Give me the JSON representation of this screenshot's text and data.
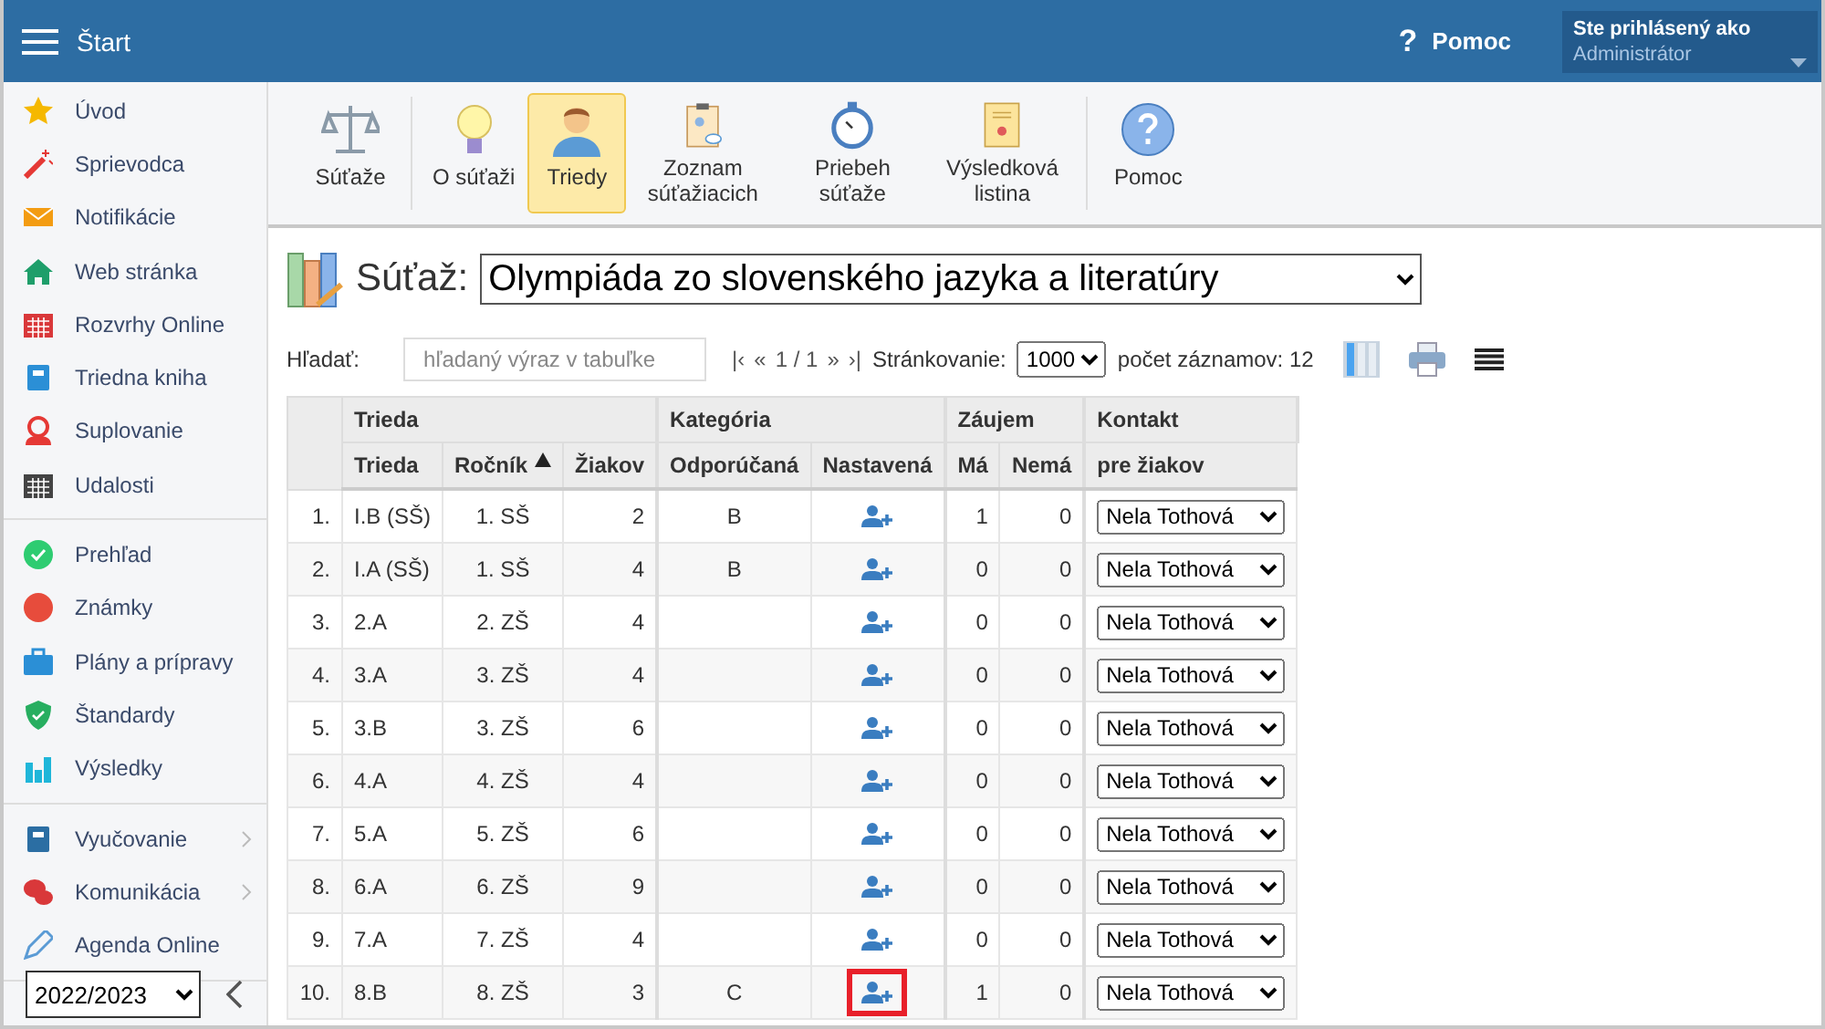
{
  "header": {
    "title": "Štart",
    "help_icon": "?",
    "help": "Pomoc",
    "user_label": "Ste prihlásený ako",
    "user_name": "Administrátor"
  },
  "sidebar": {
    "groups": [
      [
        {
          "label": "Úvod",
          "kind": "star",
          "submenu": false
        },
        {
          "label": "Sprievodca",
          "kind": "wand",
          "submenu": false
        },
        {
          "label": "Notifikácie",
          "kind": "mail",
          "submenu": false
        },
        {
          "label": "Web stránka",
          "kind": "home",
          "submenu": false
        },
        {
          "label": "Rozvrhy Online",
          "kind": "calendar",
          "submenu": false
        },
        {
          "label": "Triedna kniha",
          "kind": "book",
          "submenu": false
        },
        {
          "label": "Suplovanie",
          "kind": "person",
          "submenu": false
        },
        {
          "label": "Udalosti",
          "kind": "events",
          "submenu": false
        }
      ],
      [
        {
          "label": "Prehľad",
          "kind": "check",
          "submenu": false
        },
        {
          "label": "Známky",
          "kind": "grade",
          "submenu": false
        },
        {
          "label": "Plány a prípravy",
          "kind": "briefcase",
          "submenu": false
        },
        {
          "label": "Štandardy",
          "kind": "shield",
          "submenu": false
        },
        {
          "label": "Výsledky",
          "kind": "chart",
          "submenu": false
        }
      ],
      [
        {
          "label": "Vyučovanie",
          "kind": "reading",
          "submenu": true
        },
        {
          "label": "Komunikácia",
          "kind": "chat",
          "submenu": true
        },
        {
          "label": "Agenda Online",
          "kind": "pen",
          "submenu": false
        }
      ]
    ],
    "year": "2022/2023"
  },
  "toolbar": [
    [
      {
        "label": "Súťaže",
        "kind": "scales",
        "selected": false
      }
    ],
    [
      {
        "label": "O súťaži",
        "kind": "bulb",
        "selected": false
      },
      {
        "label": "Triedy",
        "kind": "person",
        "selected": true
      },
      {
        "label": "Zoznam súťažiacich",
        "kind": "clipboard",
        "selected": false
      },
      {
        "label": "Priebeh súťaže",
        "kind": "stopwatch",
        "selected": false
      },
      {
        "label": "Výsledková listina",
        "kind": "certificate",
        "selected": false
      }
    ],
    [
      {
        "label": "Pomoc",
        "kind": "help",
        "selected": false
      }
    ]
  ],
  "title": {
    "label": "Súťaž:",
    "value": "Olympiáda zo slovenského jazyka a literatúry"
  },
  "filter": {
    "label": "Hľadať:",
    "placeholder": "hľadaný výraz v tabuľke",
    "pager": [
      "|‹",
      "«",
      "1 / 1",
      "»",
      "›|"
    ],
    "paging_label": "Stránkovanie:",
    "paging_value": "1000",
    "count": "počet záznamov: 12"
  },
  "table": {
    "groups": [
      {
        "label": "Trieda"
      },
      {
        "label": "Kategória"
      },
      {
        "label": "Záujem"
      },
      {
        "label": "Kontakt"
      }
    ],
    "columns": [
      {
        "label": "Trieda",
        "sorted": false
      },
      {
        "label": "Ročník",
        "sorted": true
      },
      {
        "label": "Žiakov",
        "sorted": false
      },
      {
        "label": "Odporúčaná",
        "sorted": false
      },
      {
        "label": "Nastavená",
        "sorted": false
      },
      {
        "label": "Má",
        "sorted": false
      },
      {
        "label": "Nemá",
        "sorted": false
      },
      {
        "label": "pre žiakov",
        "sorted": false
      }
    ],
    "rows": [
      {
        "n": "1.",
        "trieda": "I.B (SŠ)",
        "rocnik": "1. SŠ",
        "ziakov": "2",
        "odporucana": "B",
        "ma": "1",
        "nema": "0",
        "kontakt": "Nela Tothová",
        "marked": false
      },
      {
        "n": "2.",
        "trieda": "I.A (SŠ)",
        "rocnik": "1. SŠ",
        "ziakov": "4",
        "odporucana": "B",
        "ma": "0",
        "nema": "0",
        "kontakt": "Nela Tothová",
        "marked": false
      },
      {
        "n": "3.",
        "trieda": "2.A",
        "rocnik": "2. ZŠ",
        "ziakov": "4",
        "odporucana": "",
        "ma": "0",
        "nema": "0",
        "kontakt": "Nela Tothová",
        "marked": false
      },
      {
        "n": "4.",
        "trieda": "3.A",
        "rocnik": "3. ZŠ",
        "ziakov": "4",
        "odporucana": "",
        "ma": "0",
        "nema": "0",
        "kontakt": "Nela Tothová",
        "marked": false
      },
      {
        "n": "5.",
        "trieda": "3.B",
        "rocnik": "3. ZŠ",
        "ziakov": "6",
        "odporucana": "",
        "ma": "0",
        "nema": "0",
        "kontakt": "Nela Tothová",
        "marked": false
      },
      {
        "n": "6.",
        "trieda": "4.A",
        "rocnik": "4. ZŠ",
        "ziakov": "4",
        "odporucana": "",
        "ma": "0",
        "nema": "0",
        "kontakt": "Nela Tothová",
        "marked": false
      },
      {
        "n": "7.",
        "trieda": "5.A",
        "rocnik": "5. ZŠ",
        "ziakov": "6",
        "odporucana": "",
        "ma": "0",
        "nema": "0",
        "kontakt": "Nela Tothová",
        "marked": false
      },
      {
        "n": "8.",
        "trieda": "6.A",
        "rocnik": "6. ZŠ",
        "ziakov": "9",
        "odporucana": "",
        "ma": "0",
        "nema": "0",
        "kontakt": "Nela Tothová",
        "marked": false
      },
      {
        "n": "9.",
        "trieda": "7.A",
        "rocnik": "7. ZŠ",
        "ziakov": "4",
        "odporucana": "",
        "ma": "0",
        "nema": "0",
        "kontakt": "Nela Tothová",
        "marked": false
      },
      {
        "n": "10.",
        "trieda": "8.B",
        "rocnik": "8. ZŠ",
        "ziakov": "3",
        "odporucana": "C",
        "ma": "1",
        "nema": "0",
        "kontakt": "Nela Tothová",
        "marked": true
      }
    ]
  }
}
